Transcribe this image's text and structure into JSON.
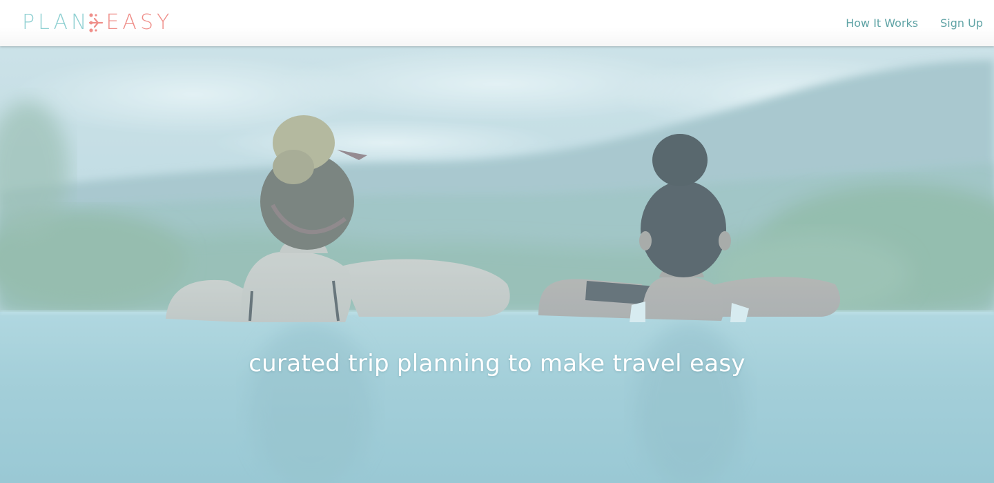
{
  "header": {
    "logo": {
      "text_left": "PLAN",
      "text_right": "EASY",
      "icon": "airplane-icon",
      "colors": {
        "left": "#8fd0d2",
        "right": "#ef8f8a"
      }
    },
    "nav": [
      {
        "label": "How It Works"
      },
      {
        "label": "Sign Up"
      }
    ],
    "nav_color": "#5fa3a5"
  },
  "hero": {
    "tagline": "curated trip planning to make travel easy",
    "tagline_color": "#ffffff"
  }
}
